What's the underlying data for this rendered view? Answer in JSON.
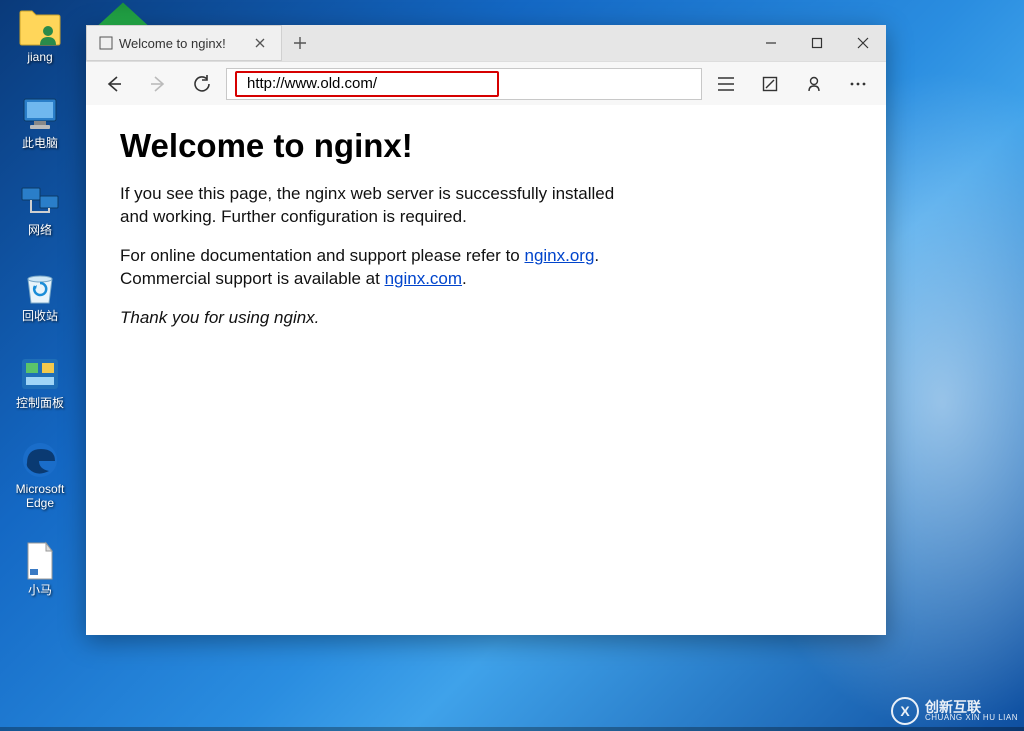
{
  "desktop": {
    "icons": [
      {
        "name": "user-folder-icon",
        "label": "jiang",
        "glyph": "user-folder"
      },
      {
        "name": "this-pc-icon",
        "label": "此电脑",
        "glyph": "pc"
      },
      {
        "name": "network-icon",
        "label": "网络",
        "glyph": "network"
      },
      {
        "name": "recycle-bin-icon",
        "label": "回收站",
        "glyph": "recycle"
      },
      {
        "name": "control-panel-icon",
        "label": "控制面板",
        "glyph": "control-panel"
      },
      {
        "name": "edge-icon",
        "label": "Microsoft Edge",
        "glyph": "edge"
      },
      {
        "name": "xiaoma-icon",
        "label": "小马",
        "glyph": "file"
      }
    ]
  },
  "browser": {
    "tab_title": "Welcome to nginx!",
    "address": "http://www.old.com/"
  },
  "page": {
    "heading": "Welcome to nginx!",
    "p1": "If you see this page, the nginx web server is successfully installed and working. Further configuration is required.",
    "p2a": "For online documentation and support please refer to ",
    "link1": "nginx.org",
    "p2b": ".",
    "p3a": "Commercial support is available at ",
    "link2": "nginx.com",
    "p3b": ".",
    "thanks": "Thank you for using nginx."
  },
  "watermark": {
    "main": "创新互联",
    "sub": "CHUANG XIN HU LIAN"
  }
}
